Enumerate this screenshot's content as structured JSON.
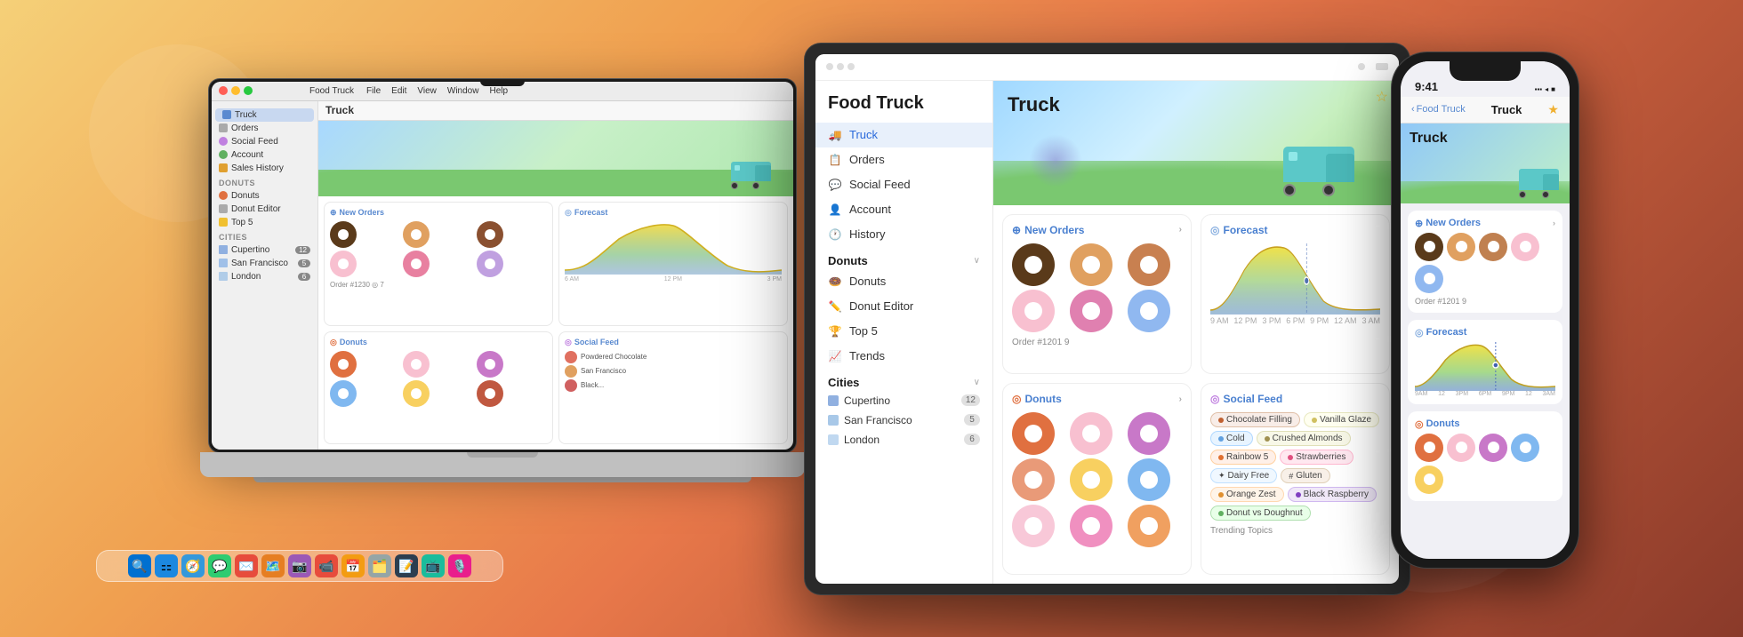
{
  "background": {
    "gradient": "warm orange"
  },
  "macbook": {
    "titlebar": {
      "app_name": "Food Truck",
      "menu_items": [
        "File",
        "Edit",
        "View",
        "Window",
        "Help"
      ],
      "window_title": "Truck"
    },
    "sidebar": {
      "items": [
        {
          "label": "Truck",
          "selected": true
        },
        {
          "label": "Orders"
        },
        {
          "label": "Social Feed"
        },
        {
          "label": "Account"
        },
        {
          "label": "Sales History"
        }
      ],
      "sections": [
        {
          "label": "Donuts",
          "items": [
            {
              "label": "Donuts"
            },
            {
              "label": "Donut Editor"
            },
            {
              "label": "Top 5"
            }
          ]
        },
        {
          "label": "Cities",
          "items": [
            {
              "label": "Cupertino",
              "badge": "12"
            },
            {
              "label": "San Francisco",
              "badge": "5"
            },
            {
              "label": "London",
              "badge": "6"
            }
          ]
        }
      ]
    },
    "main": {
      "hero_title": "Truck",
      "panels": [
        {
          "title": "New Orders"
        },
        {
          "title": "Forecast"
        },
        {
          "title": "Donuts"
        },
        {
          "title": "Social Feed"
        }
      ]
    }
  },
  "ipad": {
    "app_title": "Food Truck",
    "hero_title": "Truck",
    "nav": {
      "items": [
        {
          "label": "Truck",
          "selected": true
        },
        {
          "label": "Orders"
        },
        {
          "label": "Social Feed"
        },
        {
          "label": "Account"
        },
        {
          "label": "History"
        }
      ],
      "sections": [
        {
          "label": "Donuts",
          "items": [
            {
              "label": "Donuts"
            },
            {
              "label": "Donut Editor"
            },
            {
              "label": "Top 5"
            },
            {
              "label": "Trends"
            }
          ]
        },
        {
          "label": "Cities",
          "items": [
            {
              "label": "Cupertino",
              "badge": "12"
            },
            {
              "label": "San Francisco",
              "badge": "5"
            },
            {
              "label": "London",
              "badge": "6"
            }
          ]
        }
      ]
    },
    "panels": [
      {
        "id": "new-orders",
        "title": "New Orders",
        "order_info": "Order #1201  9"
      },
      {
        "id": "forecast",
        "title": "Forecast"
      },
      {
        "id": "donuts",
        "title": "Donuts"
      },
      {
        "id": "social-feed",
        "title": "Social Feed",
        "tags": [
          {
            "label": "Chocolate Filling",
            "color": "chocolate"
          },
          {
            "label": "Vanilla Glaze",
            "color": "vanilla"
          },
          {
            "label": "Cold",
            "color": "cold"
          },
          {
            "label": "Crushed Almonds",
            "color": "almonds"
          },
          {
            "label": "Rainbow 5",
            "color": "rainbow"
          },
          {
            "label": "Strawberries",
            "color": "strawberry"
          },
          {
            "label": "Dairy Free",
            "color": "dairy"
          },
          {
            "label": "Gluten",
            "color": "gluten"
          },
          {
            "label": "Orange Zest",
            "color": "orange"
          },
          {
            "label": "Black Raspberry",
            "color": "black"
          },
          {
            "label": "Donut vs Doughnut",
            "color": "donut"
          }
        ],
        "trending_label": "Trending Topics"
      }
    ]
  },
  "iphone": {
    "time": "9:41",
    "status": "▪▪▪ ◂ ■",
    "nav": {
      "back_label": "Food Truck",
      "title": "Truck",
      "star": "★"
    },
    "hero_title": "Truck",
    "sections": [
      {
        "title": "New Orders",
        "order_info": "Order #1201  9"
      },
      {
        "title": "Forecast"
      },
      {
        "title": "Donuts"
      }
    ]
  },
  "donuts": [
    {
      "color": "#5a3a1a",
      "glaze": "#7a5a3a"
    },
    {
      "color": "#c85040",
      "glaze": "#f080a0"
    },
    {
      "color": "#b87830",
      "glaze": "#d8a050"
    },
    {
      "color": "#f8c0d0",
      "glaze": "#ff80a0"
    },
    {
      "color": "#c0a0e0",
      "glaze": "#e0c0ff"
    },
    {
      "color": "#80c0f0",
      "glaze": "#b0e0ff"
    },
    {
      "color": "#a0d870",
      "glaze": "#c8f090"
    },
    {
      "color": "#f8e060",
      "glaze": "#fff090"
    },
    {
      "color": "#d06840",
      "glaze": "#f0a060"
    }
  ]
}
